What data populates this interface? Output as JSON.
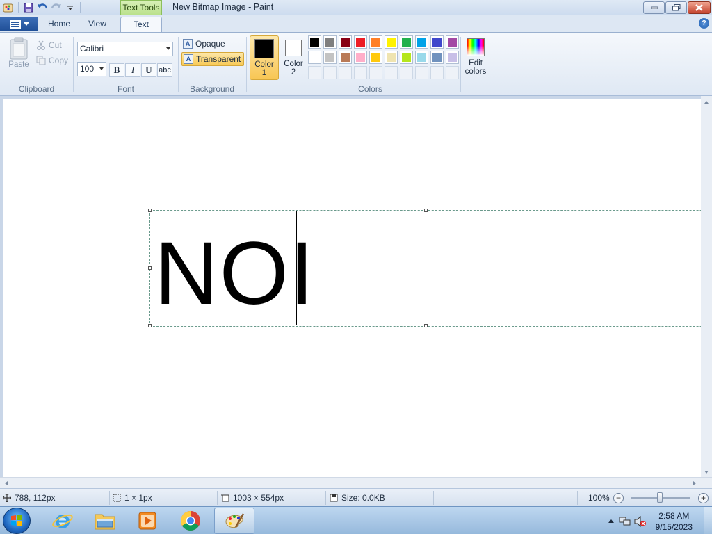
{
  "window": {
    "title": "New Bitmap Image - Paint",
    "contextual_tab": "Text Tools"
  },
  "tabs": {
    "home": "Home",
    "view": "View",
    "text": "Text"
  },
  "ribbon": {
    "clipboard": {
      "label": "Clipboard",
      "paste": "Paste",
      "cut": "Cut",
      "copy": "Copy"
    },
    "font": {
      "label": "Font",
      "family": "Calibri",
      "size": "100",
      "bold": "B",
      "italic": "I",
      "underline": "U",
      "strike": "abc"
    },
    "background": {
      "label": "Background",
      "opaque": "Opaque",
      "transparent": "Transparent",
      "selected": "Transparent"
    },
    "colors": {
      "label": "Colors",
      "color1_label": "Color",
      "color1_num": "1",
      "color1_value": "#000000",
      "color2_label": "Color",
      "color2_num": "2",
      "color2_value": "#ffffff",
      "edit_label": "Edit",
      "edit_label2": "colors",
      "palette_row1": [
        "#000000",
        "#7f7f7f",
        "#880015",
        "#ed1c24",
        "#ff7f27",
        "#fff200",
        "#22b14c",
        "#00a2e8",
        "#3f48cc",
        "#a349a4"
      ],
      "palette_row2": [
        "#ffffff",
        "#c3c3c3",
        "#b97a57",
        "#ffaec9",
        "#ffc90e",
        "#efe4b0",
        "#b5e61d",
        "#99d9ea",
        "#7092be",
        "#c8bfe7"
      ]
    }
  },
  "canvas": {
    "text": "NOI"
  },
  "status": {
    "cursor_pos": "788, 112px",
    "selection_size": "1 × 1px",
    "image_size": "1003 × 554px",
    "file_size": "Size: 0.0KB",
    "zoom": "100%"
  },
  "taskbar": {
    "time": "2:58 AM",
    "date": "9/15/2023"
  }
}
